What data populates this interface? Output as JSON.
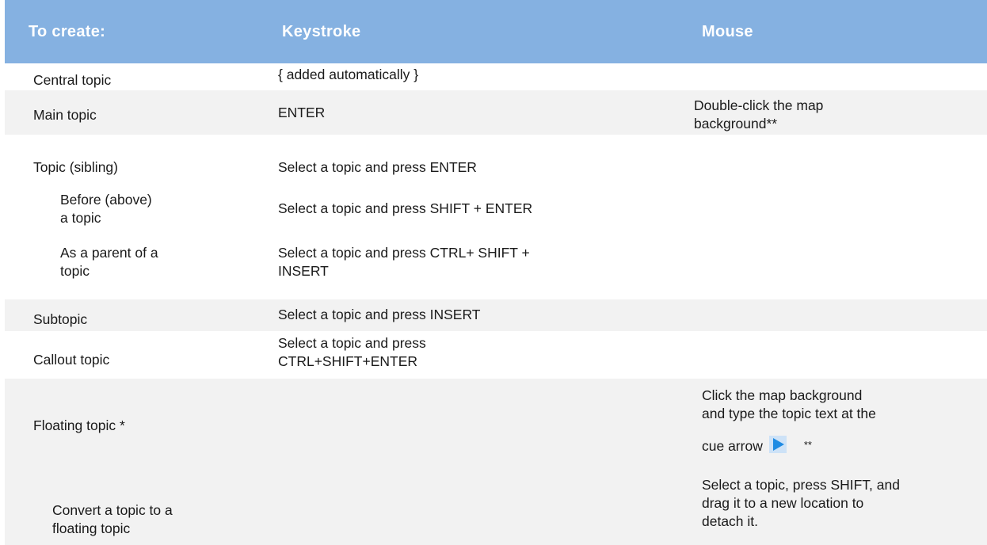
{
  "headers": {
    "create": "To create:",
    "keystroke": "Keystroke",
    "mouse": "Mouse"
  },
  "rows": [
    {
      "create": "Central topic",
      "keystroke": "{ added automatically }"
    },
    {
      "create": "Main topic",
      "keystroke": "ENTER",
      "mouse": [
        "Double-click the map",
        "background**"
      ]
    },
    {
      "create": "Topic (sibling)",
      "keystroke": "Select a topic and press ENTER"
    },
    {
      "create": [
        "Before (above)",
        "a  topic"
      ],
      "keystroke": "Select a topic and press SHIFT + ENTER"
    },
    {
      "create": [
        "As a parent of a",
        "topic"
      ],
      "keystroke": [
        "Select a topic and press CTRL+ SHIFT +",
        "INSERT"
      ]
    },
    {
      "create": "Subtopic",
      "keystroke": "Select a topic and press INSERT"
    },
    {
      "create": "Callout topic",
      "keystroke": [
        "Select a topic and press",
        "CTRL+SHIFT+ENTER"
      ]
    },
    {
      "create": "Floating topic *",
      "mouse": [
        "Click the map background",
        "and  type the topic text at the",
        "cue arrow",
        "**"
      ]
    },
    {
      "create": [
        "Convert a topic to a",
        "floating topic"
      ],
      "mouse": [
        "Select a topic, press SHIFT, and",
        "drag it to a new location to",
        "detach it."
      ]
    }
  ],
  "icons": {
    "cue_arrow": "play-triangle-icon"
  },
  "colors": {
    "header_bg": "#85b1e1",
    "shaded_row": "#f2f2f2",
    "cue_arrow": "#1e8be3"
  }
}
